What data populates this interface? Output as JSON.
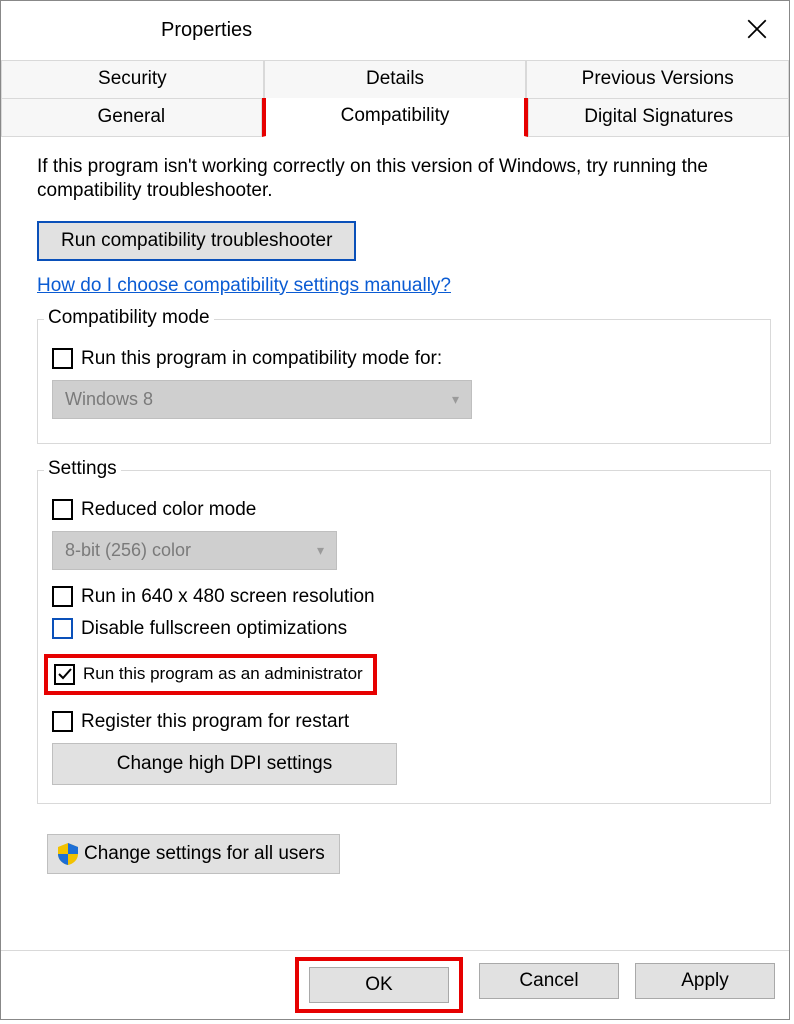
{
  "window": {
    "title": "Properties"
  },
  "tabs": {
    "row1": [
      "Security",
      "Details",
      "Previous Versions"
    ],
    "row2": [
      "General",
      "Compatibility",
      "Digital Signatures"
    ],
    "active": "Compatibility"
  },
  "intro": "If this program isn't working correctly on this version of Windows, try running the compatibility troubleshooter.",
  "troubleshooter_button": "Run compatibility troubleshooter",
  "help_link": "How do I choose compatibility settings manually?",
  "compat_mode": {
    "legend": "Compatibility mode",
    "checkbox_label": "Run this program in compatibility mode for:",
    "checked": false,
    "select_value": "Windows 8"
  },
  "settings": {
    "legend": "Settings",
    "reduced_color": {
      "label": "Reduced color mode",
      "checked": false
    },
    "color_select_value": "8-bit (256) color",
    "lowres": {
      "label": "Run in 640 x 480 screen resolution",
      "checked": false
    },
    "disable_fullscreen": {
      "label": "Disable fullscreen optimizations",
      "checked": false
    },
    "run_as_admin": {
      "label": "Run this program as an administrator",
      "checked": true
    },
    "register_restart": {
      "label": "Register this program for restart",
      "checked": false
    },
    "dpi_button": "Change high DPI settings"
  },
  "all_users_button": "Change settings for all users",
  "footer": {
    "ok": "OK",
    "cancel": "Cancel",
    "apply": "Apply"
  }
}
